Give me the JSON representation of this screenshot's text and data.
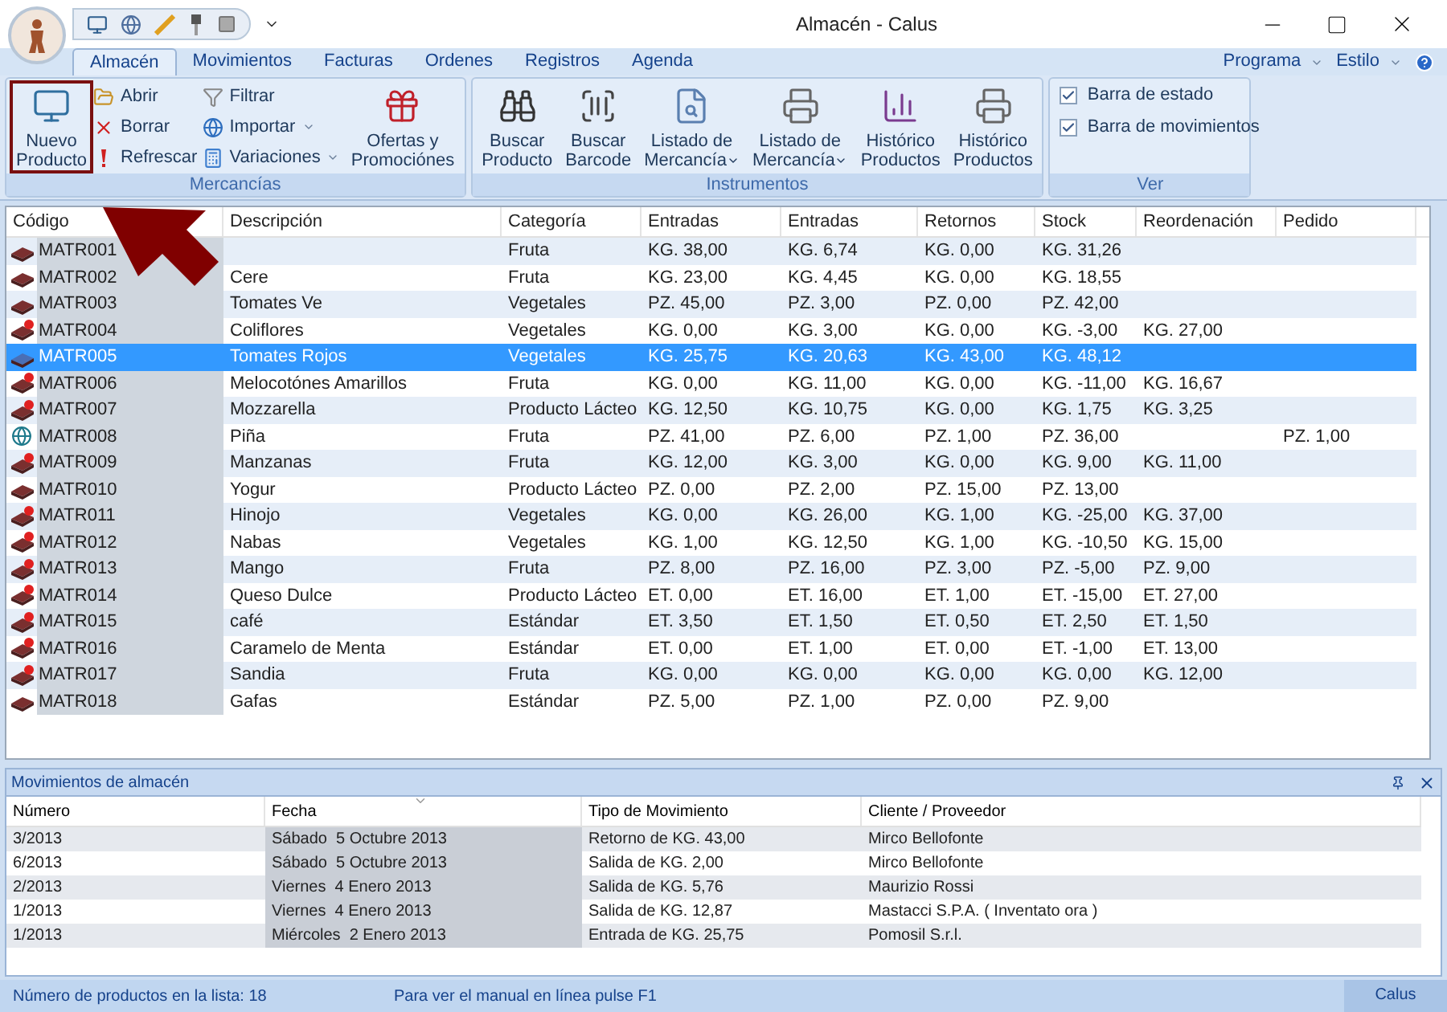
{
  "window": {
    "title": "Almacén - Calus"
  },
  "tabs": [
    {
      "label": "Almacén",
      "selected": true
    },
    {
      "label": "Movimientos",
      "selected": false
    },
    {
      "label": "Facturas",
      "selected": false
    },
    {
      "label": "Ordenes",
      "selected": false
    },
    {
      "label": "Registros",
      "selected": false
    },
    {
      "label": "Agenda",
      "selected": false
    }
  ],
  "menu_right": [
    {
      "label": "Programa"
    },
    {
      "label": "Estilo"
    }
  ],
  "ribbon": {
    "groups": [
      {
        "label": "Mercancías",
        "items": [
          {
            "kind": "large",
            "lines": [
              "Nuevo",
              "Producto"
            ],
            "highlighted": true,
            "dropdown": false
          },
          {
            "kind": "stack",
            "items": [
              {
                "label": "Abrir",
                "dropdown": false
              },
              {
                "label": "Borrar",
                "dropdown": false
              },
              {
                "label": "Refrescar",
                "dropdown": false
              }
            ]
          },
          {
            "kind": "stack",
            "items": [
              {
                "label": "Filtrar",
                "dropdown": false
              },
              {
                "label": "Importar",
                "dropdown": true
              },
              {
                "label": "Variaciones",
                "dropdown": true
              }
            ]
          },
          {
            "kind": "large",
            "lines": [
              "Ofertas y",
              "Promociónes"
            ],
            "highlighted": false,
            "dropdown": false
          }
        ]
      },
      {
        "label": "Instrumentos",
        "items": [
          {
            "kind": "large",
            "lines": [
              "Buscar",
              "Producto"
            ],
            "highlighted": false,
            "dropdown": false
          },
          {
            "kind": "large",
            "lines": [
              "Buscar",
              "Barcode"
            ],
            "highlighted": false,
            "dropdown": false
          },
          {
            "kind": "large",
            "lines": [
              "Listado de",
              "Mercancía"
            ],
            "highlighted": false,
            "dropdown": true
          },
          {
            "kind": "large",
            "lines": [
              "Listado de",
              "Mercancía"
            ],
            "highlighted": false,
            "dropdown": true
          },
          {
            "kind": "large",
            "lines": [
              "Histórico",
              "Productos"
            ],
            "highlighted": false,
            "dropdown": false
          },
          {
            "kind": "large",
            "lines": [
              "Histórico",
              "Productos"
            ],
            "highlighted": false,
            "dropdown": false
          }
        ]
      },
      {
        "label": "Ver",
        "items": [
          {
            "kind": "check",
            "label": "Barra de estado",
            "checked": true
          },
          {
            "kind": "check",
            "label": "Barra de movimientos",
            "checked": true
          }
        ]
      }
    ]
  },
  "table": {
    "columns": [
      "Código",
      "Descripción",
      "Categoría",
      "Entradas",
      "Entradas",
      "Retornos",
      "Stock",
      "Reordenación",
      "Pedido"
    ],
    "rows": [
      {
        "kind": "plain",
        "selected": false,
        "cells": [
          "MATR001",
          null,
          "Fruta",
          "KG. 38,00",
          "KG. 6,74",
          "KG. 0,00",
          "KG. 31,26",
          null,
          null
        ]
      },
      {
        "kind": "plain",
        "selected": false,
        "cells": [
          "MATR002",
          "Cere",
          "Fruta",
          "KG. 23,00",
          "KG. 4,45",
          "KG. 0,00",
          "KG. 18,55",
          null,
          null
        ]
      },
      {
        "kind": "plain",
        "selected": false,
        "cells": [
          "MATR003",
          "Tomates Ve",
          "Vegetales",
          "PZ. 45,00",
          "PZ. 3,00",
          "PZ. 0,00",
          "PZ. 42,00",
          null,
          null
        ]
      },
      {
        "kind": "alert",
        "selected": false,
        "cells": [
          "MATR004",
          "Coliflores",
          "Vegetales",
          "KG. 0,00",
          "KG. 3,00",
          "KG. 0,00",
          "KG. -3,00",
          "KG. 27,00",
          null
        ]
      },
      {
        "kind": "plain",
        "selected": true,
        "cells": [
          "MATR005",
          "Tomates Rojos",
          "Vegetales",
          "KG. 25,75",
          "KG. 20,63",
          "KG. 43,00",
          "KG. 48,12",
          null,
          null
        ]
      },
      {
        "kind": "alert",
        "selected": false,
        "cells": [
          "MATR006",
          "Melocotónes Amarillos",
          "Fruta",
          "KG. 0,00",
          "KG. 11,00",
          "KG. 0,00",
          "KG. -11,00",
          "KG. 16,67",
          null
        ]
      },
      {
        "kind": "alert",
        "selected": false,
        "cells": [
          "MATR007",
          "Mozzarella",
          "Producto Lácteo",
          "KG. 12,50",
          "KG. 10,75",
          "KG. 0,00",
          "KG. 1,75",
          "KG. 3,25",
          null
        ]
      },
      {
        "kind": "globe",
        "selected": false,
        "cells": [
          "MATR008",
          "Piña",
          "Fruta",
          "PZ. 41,00",
          "PZ. 6,00",
          "PZ. 1,00",
          "PZ. 36,00",
          null,
          "PZ. 1,00"
        ]
      },
      {
        "kind": "alert",
        "selected": false,
        "cells": [
          "MATR009",
          "Manzanas",
          "Fruta",
          "KG. 12,00",
          "KG. 3,00",
          "KG. 0,00",
          "KG. 9,00",
          "KG. 11,00",
          null
        ]
      },
      {
        "kind": "plain",
        "selected": false,
        "cells": [
          "MATR010",
          "Yogur",
          "Producto Lácteo",
          "PZ. 0,00",
          "PZ. 2,00",
          "PZ. 15,00",
          "PZ. 13,00",
          null,
          null
        ]
      },
      {
        "kind": "alert",
        "selected": false,
        "cells": [
          "MATR011",
          "Hinojo",
          "Vegetales",
          "KG. 0,00",
          "KG. 26,00",
          "KG. 1,00",
          "KG. -25,00",
          "KG. 37,00",
          null
        ]
      },
      {
        "kind": "alert",
        "selected": false,
        "cells": [
          "MATR012",
          "Nabas",
          "Vegetales",
          "KG. 1,00",
          "KG. 12,50",
          "KG. 1,00",
          "KG. -10,50",
          "KG. 15,00",
          null
        ]
      },
      {
        "kind": "alert",
        "selected": false,
        "cells": [
          "MATR013",
          "Mango",
          "Fruta",
          "PZ. 8,00",
          "PZ. 16,00",
          "PZ. 3,00",
          "PZ. -5,00",
          "PZ. 9,00",
          null
        ]
      },
      {
        "kind": "alert",
        "selected": false,
        "cells": [
          "MATR014",
          "Queso Dulce",
          "Producto Lácteo",
          "ET. 0,00",
          "ET. 16,00",
          "ET. 1,00",
          "ET. -15,00",
          "ET. 27,00",
          null
        ]
      },
      {
        "kind": "alert",
        "selected": false,
        "cells": [
          "MATR015",
          "café",
          "Estándar",
          "ET. 3,50",
          "ET. 1,50",
          "ET. 0,50",
          "ET. 2,50",
          "ET. 1,50",
          null
        ]
      },
      {
        "kind": "alert",
        "selected": false,
        "cells": [
          "MATR016",
          "Caramelo de Menta",
          "Estándar",
          "ET. 0,00",
          "ET. 1,00",
          "ET. 0,00",
          "ET. -1,00",
          "ET. 13,00",
          null
        ]
      },
      {
        "kind": "alert",
        "selected": false,
        "cells": [
          "MATR017",
          "Sandia",
          "Fruta",
          "KG. 0,00",
          "KG. 0,00",
          "KG. 0,00",
          "KG. 0,00",
          "KG. 12,00",
          null
        ]
      },
      {
        "kind": "plain",
        "selected": false,
        "cells": [
          "MATR018",
          "Gafas",
          "Estándar",
          "PZ. 5,00",
          "PZ. 1,00",
          "PZ. 0,00",
          "PZ. 9,00",
          null,
          null
        ]
      }
    ]
  },
  "movements": {
    "title": "Movimientos de almacén",
    "columns": [
      "Número",
      "Fecha",
      "Tipo de Movimiento",
      "Cliente / Proveedor"
    ],
    "rows": [
      [
        "3/2013",
        "Sábado  5 Octubre 2013",
        "Retorno de KG. 43,00",
        "Mirco Bellofonte"
      ],
      [
        "6/2013",
        "Sábado  5 Octubre 2013",
        "Salida de KG. 2,00",
        "Mirco Bellofonte"
      ],
      [
        "2/2013",
        "Viernes  4 Enero 2013",
        "Salida de KG. 5,76",
        "Maurizio Rossi"
      ],
      [
        "1/2013",
        "Viernes  4 Enero 2013",
        "Salida de KG. 12,87",
        "Mastacci S.P.A. ( Inventato ora )"
      ],
      [
        "1/2013",
        "Miércoles  2 Enero 2013",
        "Entrada de KG. 25,75",
        "Pomosil S.r.l."
      ]
    ]
  },
  "status_bar": {
    "left": "Número de productos en la lista: 18",
    "center": "Para ver el manual en línea pulse F1",
    "right": "Calus"
  }
}
